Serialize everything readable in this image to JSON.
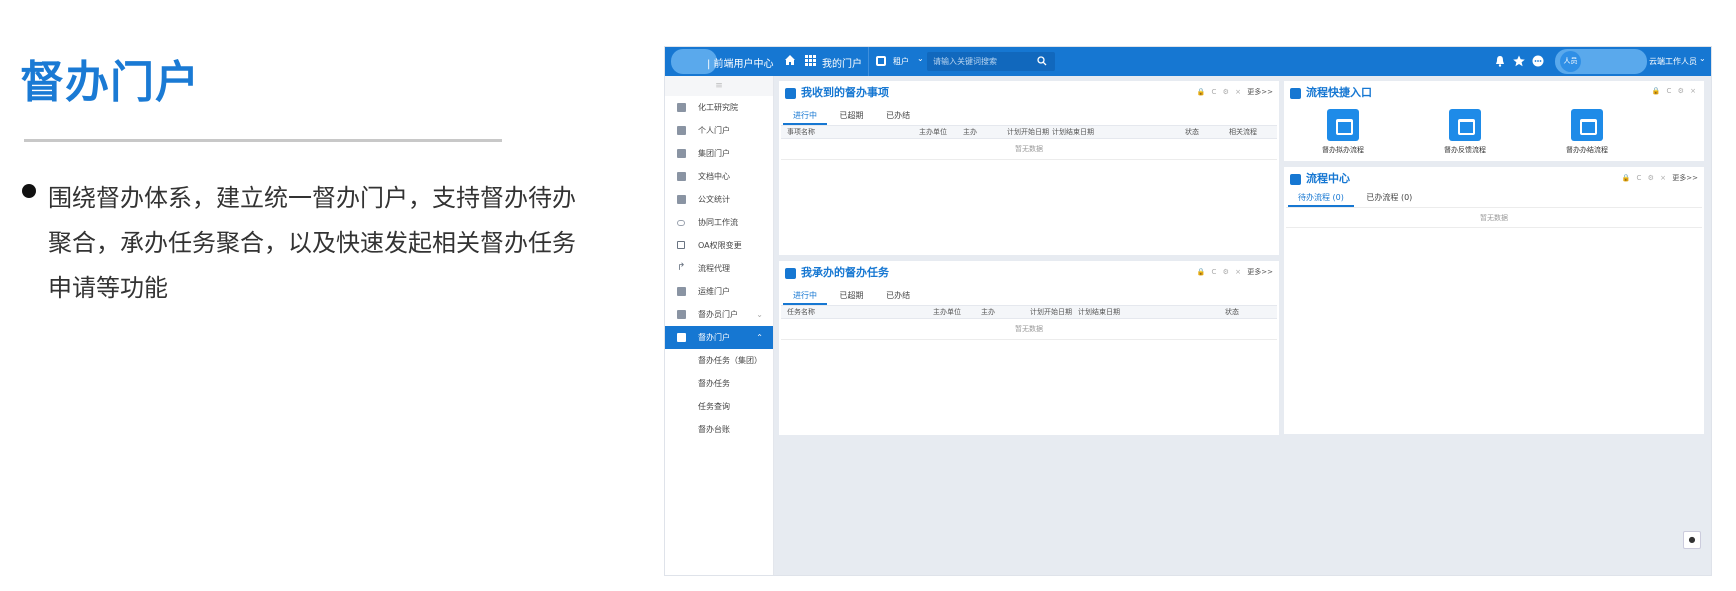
{
  "slide": {
    "title": "督办门户",
    "bullet": "围绕督办体系，建立统一督办门户，支持督办待办聚合，承办任务聚合，以及快速发起相关督办任务申请等功能"
  },
  "topbar": {
    "app_name": "| 前端用户中心",
    "my_portal": "我的门户",
    "scope": "租户",
    "search_placeholder": "请输入关键词搜索",
    "avatar_text": "人员",
    "user_name": "云端工作人员"
  },
  "sidebar": {
    "collapse_icon": "≡",
    "items": [
      {
        "label": "化工研究院",
        "icon": "table-icon"
      },
      {
        "label": "个人门户",
        "icon": "table-icon"
      },
      {
        "label": "集团门户",
        "icon": "table-icon"
      },
      {
        "label": "文档中心",
        "icon": "table-icon"
      },
      {
        "label": "公文统计",
        "icon": "table-icon"
      },
      {
        "label": "协同工作流",
        "icon": "heart-icon"
      },
      {
        "label": "OA权限变更",
        "icon": "edit-icon"
      },
      {
        "label": "流程代理",
        "icon": "share-icon"
      },
      {
        "label": "运维门户",
        "icon": "table-icon"
      },
      {
        "label": "督办员门户",
        "icon": "table-icon"
      },
      {
        "label": "督办门户",
        "icon": "table-icon"
      }
    ],
    "subitems": [
      "督办任务（集团）",
      "督办任务",
      "任务查询",
      "督办台账"
    ]
  },
  "panel_received": {
    "title": "我收到的督办事项",
    "tools": "🔒 C ⚙ ×",
    "more": "更多>>",
    "tabs": [
      "进行中",
      "已超期",
      "已办结"
    ],
    "columns": [
      "事项名称",
      "主办单位",
      "主办",
      "计划开始日期",
      "计划结束日期",
      "状态",
      "相关流程"
    ],
    "empty": "暂无数据"
  },
  "panel_tasks": {
    "title": "我承办的督办任务",
    "tools": "🔒 C ⚙ ×",
    "more": "更多>>",
    "tabs": [
      "进行中",
      "已超期",
      "已办结"
    ],
    "columns": [
      "任务名称",
      "主办单位",
      "主办",
      "计划开始日期",
      "计划结束日期",
      "状态"
    ],
    "empty": "暂无数据"
  },
  "panel_quick": {
    "title": "流程快捷入口",
    "tools": "🔒 C ⚙ ×",
    "entries": [
      "督办拟办流程",
      "督办反馈流程",
      "督办办结流程"
    ]
  },
  "panel_flow": {
    "title": "流程中心",
    "tools": "🔒 C ⚙ ×",
    "more": "更多>>",
    "tabs": [
      "待办流程 (0)",
      "已办流程 (0)"
    ],
    "empty": "暂无数据"
  },
  "colors": {
    "accent": "#1677d2",
    "title_blue": "#1a7ad4",
    "background": "#e7ebf1"
  }
}
